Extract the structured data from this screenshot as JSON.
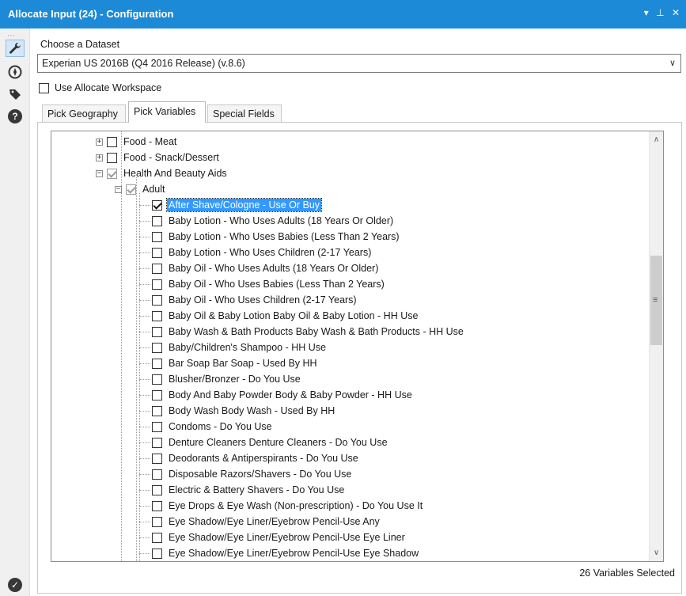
{
  "window": {
    "title": "Allocate Input (24) - Configuration",
    "controls": [
      "▾",
      "⊥",
      "✕"
    ]
  },
  "rail": {
    "grip": "⋯",
    "items": [
      {
        "icon": "wrench-icon",
        "glyph": "🔧",
        "active": true
      },
      {
        "icon": "compass-icon",
        "glyph": "⊛",
        "active": false
      },
      {
        "icon": "tag-icon",
        "glyph": "◆",
        "active": false
      },
      {
        "icon": "help-icon",
        "glyph": "?",
        "active": false
      }
    ],
    "bottom_icon": {
      "icon": "check-circle-icon",
      "glyph": "✓"
    }
  },
  "dataset": {
    "label": "Choose a Dataset",
    "value": "Experian US 2016B (Q4 2016 Release) (v.8.6)",
    "arrow": "∨"
  },
  "workspace": {
    "label": "Use Allocate Workspace",
    "checked": false
  },
  "tabs": [
    "Pick Geography",
    "Pick Variables",
    "Special Fields"
  ],
  "active_tab": "Pick Variables",
  "tree": {
    "categories": [
      {
        "label": "Food - Meat",
        "state": "unchecked",
        "expander": "+"
      },
      {
        "label": "Food - Snack/Dessert",
        "state": "unchecked",
        "expander": "+"
      },
      {
        "label": "Health And Beauty Aids",
        "state": "partial",
        "expander": "−"
      }
    ],
    "subcategory": {
      "label": "Adult",
      "state": "partial",
      "expander": "−"
    },
    "items": [
      {
        "label": "After Shave/Cologne - Use Or Buy",
        "checked": true,
        "selected": true
      },
      {
        "label": "Baby Lotion - Who Uses Adults (18 Years Or Older)",
        "checked": false
      },
      {
        "label": "Baby Lotion - Who Uses Babies (Less Than 2 Years)",
        "checked": false
      },
      {
        "label": "Baby Lotion - Who Uses Children (2-17 Years)",
        "checked": false
      },
      {
        "label": "Baby Oil - Who Uses Adults (18 Years Or Older)",
        "checked": false
      },
      {
        "label": "Baby Oil - Who Uses Babies (Less Than 2 Years)",
        "checked": false
      },
      {
        "label": "Baby Oil - Who Uses Children (2-17 Years)",
        "checked": false
      },
      {
        "label": "Baby Oil & Baby Lotion  Baby Oil & Baby Lotion - HH Use",
        "checked": false
      },
      {
        "label": "Baby Wash & Bath Products Baby Wash & Bath Products - HH Use",
        "checked": false
      },
      {
        "label": "Baby/Children's Shampoo - HH Use",
        "checked": false
      },
      {
        "label": "Bar Soap  Bar Soap - Used By HH",
        "checked": false
      },
      {
        "label": "Blusher/Bronzer - Do You Use",
        "checked": false
      },
      {
        "label": "Body And Baby Powder  Body & Baby Powder - HH Use",
        "checked": false
      },
      {
        "label": "Body Wash Body Wash - Used By HH",
        "checked": false
      },
      {
        "label": "Condoms - Do You Use",
        "checked": false
      },
      {
        "label": "Denture Cleaners Denture Cleaners - Do You Use",
        "checked": false
      },
      {
        "label": "Deodorants & Antiperspirants - Do You Use",
        "checked": false
      },
      {
        "label": "Disposable Razors/Shavers - Do You Use",
        "checked": false
      },
      {
        "label": "Electric & Battery Shavers - Do You Use",
        "checked": false
      },
      {
        "label": "Eye Drops & Eye Wash (Non-prescription)  - Do You Use It",
        "checked": false
      },
      {
        "label": "Eye Shadow/Eye Liner/Eyebrow Pencil-Use Any",
        "checked": false
      },
      {
        "label": "Eye Shadow/Eye Liner/Eyebrow Pencil-Use Eye Liner",
        "checked": false
      },
      {
        "label": "Eye Shadow/Eye Liner/Eyebrow Pencil-Use Eye Shadow",
        "checked": false
      }
    ]
  },
  "scrollbar": {
    "up": "∧",
    "down": "∨",
    "grip": "≡"
  },
  "status": "26 Variables Selected"
}
